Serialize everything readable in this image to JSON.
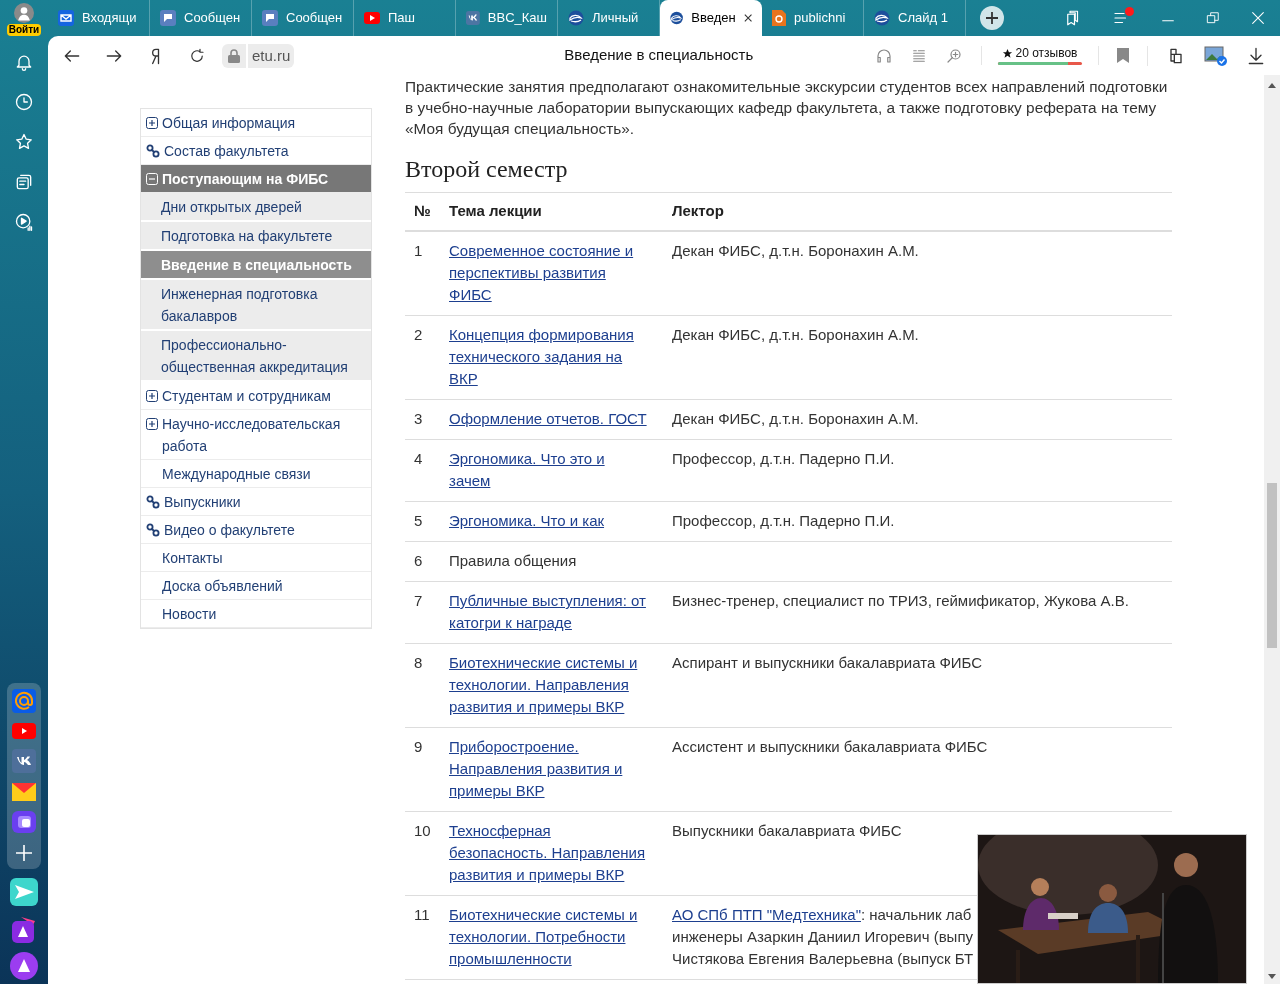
{
  "browser": {
    "login": "Войти",
    "tabs": [
      {
        "kind": "mail",
        "label": "Входящи",
        "selected": false
      },
      {
        "kind": "chat",
        "label": "Сообщен",
        "selected": false
      },
      {
        "kind": "chat",
        "label": "Сообщен",
        "selected": false
      },
      {
        "kind": "youtube",
        "label": "Паш",
        "selected": false
      },
      {
        "kind": "vk",
        "label": "BBC_Каш",
        "selected": false
      },
      {
        "kind": "edge",
        "label": "Личный",
        "selected": false
      },
      {
        "kind": "edge",
        "label": "Введен",
        "selected": true
      },
      {
        "kind": "doc",
        "label": "publichni",
        "selected": false
      },
      {
        "kind": "edge",
        "label": "Слайд 1",
        "selected": false
      }
    ],
    "address": "etu.ru",
    "page_title": "Введение в специальность",
    "reviews": "20 отзывов",
    "rating": {
      "level": 0.83
    }
  },
  "nav": [
    {
      "kind": "group",
      "label": "Общая информация",
      "expanded": false
    },
    {
      "kind": "link",
      "label": "Состав факультета"
    },
    {
      "kind": "group",
      "label": "Поступающим на ФИБС",
      "expanded": true,
      "children": [
        {
          "label": "Дни открытых дверей",
          "selected": false
        },
        {
          "label": "Подготовка на факультете",
          "selected": false
        },
        {
          "label": "Введение в специальность",
          "selected": true
        },
        {
          "label": "Инженерная подготовка бакалавров",
          "selected": false
        },
        {
          "label": "Профессионально-общественная аккредитация",
          "selected": false
        }
      ]
    },
    {
      "kind": "group",
      "label": "Студентам и сотрудникам",
      "expanded": false
    },
    {
      "kind": "group",
      "label": "Научно-исследовательская работа",
      "expanded": false
    },
    {
      "kind": "page",
      "label": "Международные связи"
    },
    {
      "kind": "link",
      "label": "Выпускники"
    },
    {
      "kind": "link",
      "label": "Видео о факультете"
    },
    {
      "kind": "page",
      "label": "Контакты"
    },
    {
      "kind": "page",
      "label": "Доска объявлений"
    },
    {
      "kind": "page",
      "label": "Новости"
    }
  ],
  "intro": "Практические занятия предполагают ознакомительные экскурсии студентов всех направлений подготовки в учебно-научные лаборатории выпускающих кафедр факультета, а также подготовку реферата на тему «Моя будущая специальность».",
  "heading": "Второй семестр",
  "table": {
    "columns": [
      "№",
      "Тема лекции",
      "Лектор"
    ],
    "rows": [
      {
        "num": "1",
        "topic": "Современное состояние и перспективы развития ФИБС",
        "topic_link": true,
        "lecturer": "Декан ФИБС, д.т.н. Боронахин А.М."
      },
      {
        "num": "2",
        "topic": "Концепция формирования технического задания на ВКР",
        "topic_link": true,
        "lecturer": "Декан ФИБС, д.т.н. Боронахин А.М."
      },
      {
        "num": "3",
        "topic": "Оформление отчетов. ГОСТ",
        "topic_link": true,
        "lecturer": "Декан ФИБС, д.т.н. Боронахин А.М."
      },
      {
        "num": "4",
        "topic": "Эргономика. Что это и зачем",
        "topic_link": true,
        "lecturer": "Профессор, д.т.н. Падерно П.И."
      },
      {
        "num": "5",
        "topic": "Эргономика. Что и как",
        "topic_link": true,
        "lecturer": "Профессор, д.т.н. Падерно П.И."
      },
      {
        "num": "6",
        "topic": "Правила общения",
        "topic_link": false,
        "lecturer": ""
      },
      {
        "num": "7",
        "topic": "Публичные выступления: от катогри к награде",
        "topic_link": true,
        "lecturer": "Бизнес-тренер, специалист по ТРИЗ, геймификатор, Жукова А.В."
      },
      {
        "num": "8",
        "topic": "Биотехнические системы и технологии. Направления развития и примеры ВКР",
        "topic_link": true,
        "lecturer": "Аспирант и выпускники бакалавриата ФИБС"
      },
      {
        "num": "9",
        "topic": "Приборостроение. Направления развития и примеры ВКР",
        "topic_link": true,
        "lecturer": "Ассистент и выпускники бакалавриата ФИБС"
      },
      {
        "num": "10",
        "topic": "Техносферная безопасность. Направления развития и примеры ВКР",
        "topic_link": true,
        "lecturer": "Выпускники бакалавриата ФИБС"
      },
      {
        "num": "11",
        "topic": "Биотехнические системы и технологии. Потребности промышленности",
        "topic_link": true,
        "lecturer_link": "АО СПб ПТП \"Медтехника\"",
        "lecturer_lines": [
          ": начальник лаб",
          "инженеры Азаркин Даниил Игоревич (выпу",
          "Чистякова Евгения Валерьевна (выпуск БТ"
        ]
      }
    ]
  }
}
